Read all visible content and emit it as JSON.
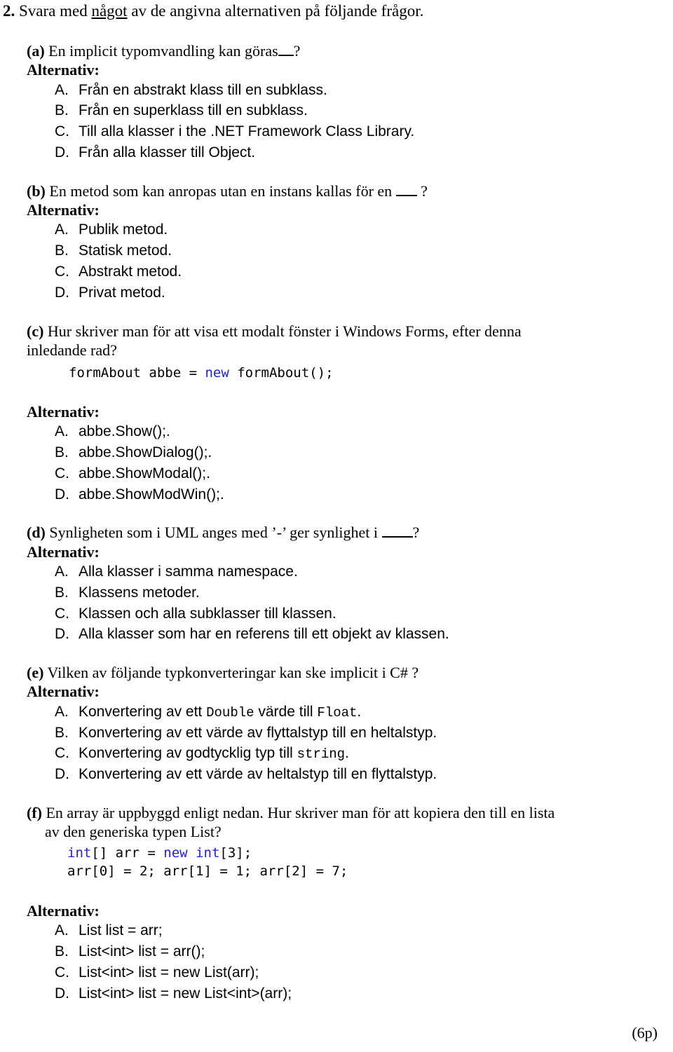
{
  "page": {
    "item_number": "2.",
    "item_intro_before": "Svara med ",
    "item_intro_underlined": "något",
    "item_intro_after": " av de angivna alternativen på följande frågor.",
    "alternativ_label": "Alternativ:",
    "points": "(6p)"
  },
  "questions": [
    {
      "label": "(a)",
      "text": "En implicit typomvandling kan göras",
      "text_after_blank": "?",
      "alternativ_label": "Alternativ:",
      "options": [
        {
          "letter": "A.",
          "text": "Från en abstrakt klass till en subklass."
        },
        {
          "letter": "B.",
          "text": "Från en superklass till en subklass."
        },
        {
          "letter": "C.",
          "text": "Till alla klasser i the .NET Framework Class Library."
        },
        {
          "letter": "D.",
          "text": "Från alla klasser till Object."
        }
      ]
    },
    {
      "label": "(b)",
      "text": "En metod som kan anropas utan en instans kallas för en ",
      "text_after_blank": " ?",
      "alternativ_label": "Alternativ:",
      "options": [
        {
          "letter": "A.",
          "text": "Publik metod."
        },
        {
          "letter": "B.",
          "text": "Statisk metod."
        },
        {
          "letter": "C.",
          "text": "Abstrakt metod."
        },
        {
          "letter": "D.",
          "text": "Privat metod."
        }
      ]
    },
    {
      "label": "(c)",
      "text": "Hur skriver man för att visa ett modalt fönster i Windows Forms, efter denna",
      "text_line2": "inledande rad?",
      "code": [
        {
          "plain1": "formAbout abbe = ",
          "keyword": "new",
          "plain2": " formAbout();"
        }
      ],
      "alternativ_label": "Alternativ:",
      "options": [
        {
          "letter": "A.",
          "text": "abbe.Show();."
        },
        {
          "letter": "B.",
          "text": "abbe.ShowDialog();."
        },
        {
          "letter": "C.",
          "text": "abbe.ShowModal();."
        },
        {
          "letter": "D.",
          "text": "abbe.ShowModWin();."
        }
      ]
    },
    {
      "label": "(d)",
      "text": "Synligheten som i UML anges med ’-’ ger synlighet i ",
      "text_after_blank": "?",
      "alternativ_label": "Alternativ:",
      "options": [
        {
          "letter": "A.",
          "text": "Alla klasser i samma namespace."
        },
        {
          "letter": "B.",
          "text": "Klassens metoder."
        },
        {
          "letter": "C.",
          "text": "Klassen och alla subklasser till klassen."
        },
        {
          "letter": "D.",
          "text": "Alla klasser som har en referens till ett objekt av klassen."
        }
      ]
    },
    {
      "label": "(e)",
      "text": "Vilken av följande typkonverteringar kan ske implicit i C# ?",
      "alternativ_label": "Alternativ:",
      "options": [
        {
          "letter": "A.",
          "pre": "Konvertering av ett ",
          "code1": "Double",
          "mid": " värde till ",
          "code2": "Float",
          "post": "."
        },
        {
          "letter": "B.",
          "text": "Konvertering av ett värde av flyttalstyp till en heltalstyp."
        },
        {
          "letter": "C.",
          "pre": "Konvertering av godtycklig typ till ",
          "code1": "string",
          "post": "."
        },
        {
          "letter": "D.",
          "text": "Konvertering av ett värde av heltalstyp till en flyttalstyp."
        }
      ]
    },
    {
      "label": "(f)",
      "text": "En array är uppbyggd enligt nedan. Hur skriver man för att kopiera den till en lista",
      "text_line2": "av den generiska typen List?",
      "code_line1": {
        "kw1": "int",
        "p1": "[] arr = ",
        "kw2": "new",
        "p2": " ",
        "kw3": "int",
        "p3": "[3];"
      },
      "code_line2": "arr[0] = 2; arr[1] = 1; arr[2] = 7;",
      "alternativ_label": "Alternativ:",
      "options": [
        {
          "letter": "A.",
          "text": "List list = arr;"
        },
        {
          "letter": "B.",
          "text": "List<int> list = arr();"
        },
        {
          "letter": "C.",
          "text": "List<int> list = new List(arr);"
        },
        {
          "letter": "D.",
          "text": "List<int> list = new List<int>(arr);"
        }
      ]
    }
  ]
}
